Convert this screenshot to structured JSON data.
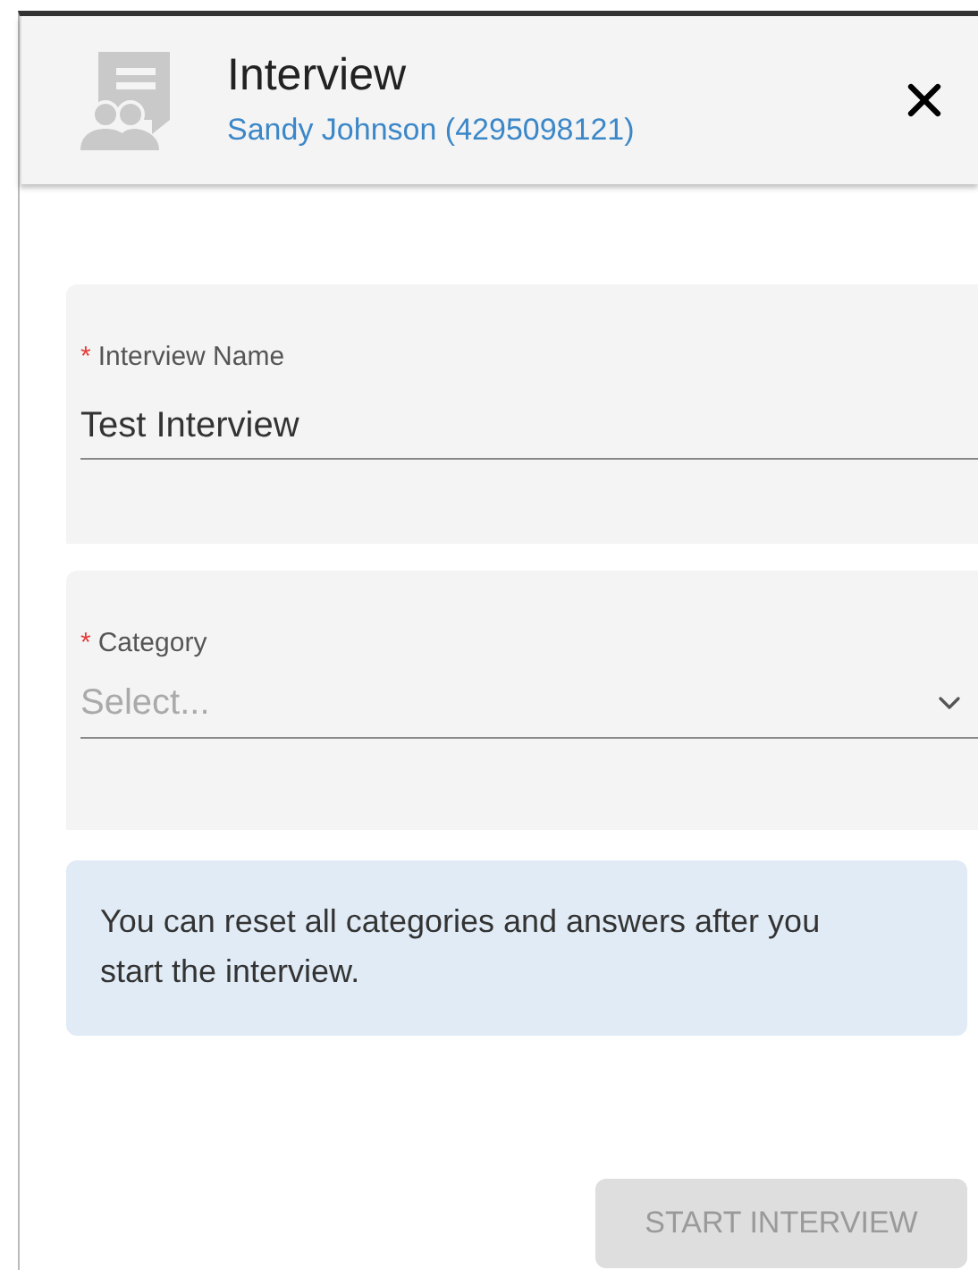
{
  "header": {
    "title": "Interview",
    "subtitle": "Sandy Johnson (4295098121)"
  },
  "fields": [
    {
      "kind": "text",
      "required_mark": "*",
      "label": "Interview Name",
      "value": "Test Interview"
    },
    {
      "kind": "select",
      "required_mark": "*",
      "label": "Category",
      "placeholder": "Select..."
    }
  ],
  "info": "You can reset all categories and answers after you start the interview.",
  "button": {
    "label": "START INTERVIEW",
    "disabled": true
  }
}
